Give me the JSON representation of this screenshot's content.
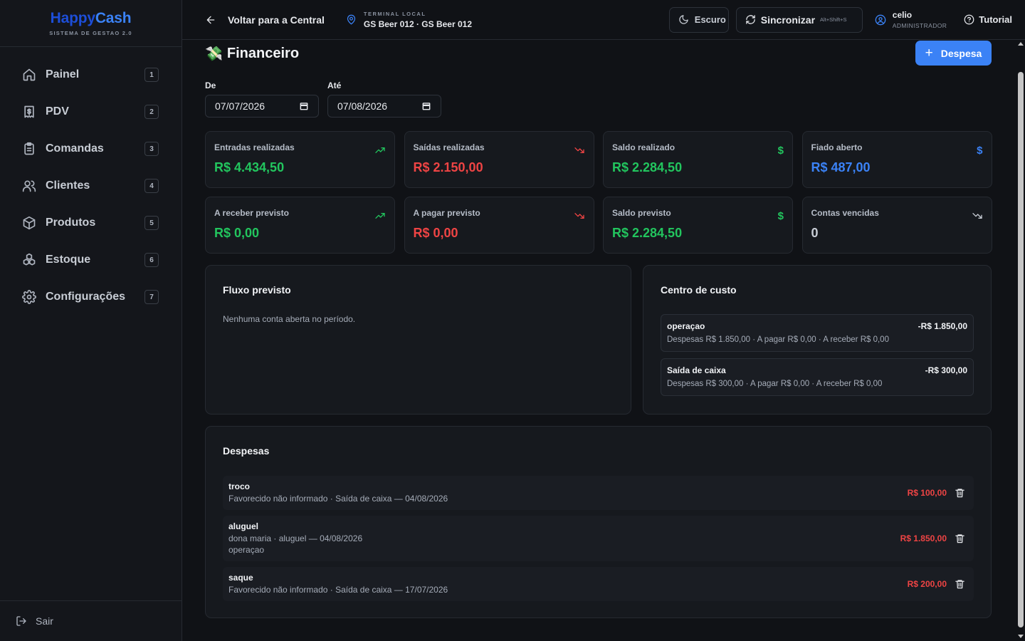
{
  "brand": {
    "name_part1": "Happy",
    "name_part2": "Cash",
    "subtitle": "SISTEMA DE GESTAO 2.0"
  },
  "sidebar": {
    "items": [
      {
        "label": "Painel",
        "shortcut": "1",
        "icon": "home-icon"
      },
      {
        "label": "PDV",
        "shortcut": "2",
        "icon": "receipt-icon"
      },
      {
        "label": "Comandas",
        "shortcut": "3",
        "icon": "clipboard-icon"
      },
      {
        "label": "Clientes",
        "shortcut": "4",
        "icon": "users-icon"
      },
      {
        "label": "Produtos",
        "shortcut": "5",
        "icon": "package-icon"
      },
      {
        "label": "Estoque",
        "shortcut": "6",
        "icon": "boxes-icon"
      },
      {
        "label": "Configurações",
        "shortcut": "7",
        "icon": "gear-icon"
      }
    ],
    "logout_label": "Sair"
  },
  "topbar": {
    "back_label": "Voltar para a Central",
    "terminal_kicker": "TERMINAL LOCAL",
    "terminal_name": "GS Beer 012 · GS Beer 012",
    "theme_label": "Escuro",
    "sync_label": "Sincronizar",
    "sync_shortcut": "Alt+Shift+S",
    "user_name": "celio",
    "user_role": "ADMINISTRADOR",
    "tutorial_label": "Tutorial"
  },
  "page": {
    "emoji": "💸",
    "title": "Financeiro",
    "add_button": "Despesa",
    "date_from_label": "De",
    "date_from_value": "07/07/2026",
    "date_to_label": "Até",
    "date_to_value": "07/08/2026"
  },
  "cards": [
    {
      "label": "Entradas realizadas",
      "value": "R$ 4.434,50",
      "color": "#22c55e",
      "icon": "trending-up-icon"
    },
    {
      "label": "Saídas realizadas",
      "value": "R$ 2.150,00",
      "color": "#ef4444",
      "icon": "trending-down-icon"
    },
    {
      "label": "Saldo realizado",
      "value": "R$ 2.284,50",
      "color": "#22c55e",
      "icon": "dollar-icon"
    },
    {
      "label": "Fiado aberto",
      "value": "R$ 487,00",
      "color": "#3b82f6",
      "icon": "dollar-icon"
    },
    {
      "label": "A receber previsto",
      "value": "R$ 0,00",
      "color": "#22c55e",
      "icon": "trending-up-icon"
    },
    {
      "label": "A pagar previsto",
      "value": "R$ 0,00",
      "color": "#ef4444",
      "icon": "trending-down-icon"
    },
    {
      "label": "Saldo previsto",
      "value": "R$ 2.284,50",
      "color": "#22c55e",
      "icon": "dollar-icon"
    },
    {
      "label": "Contas vencidas",
      "value": "0",
      "color": "#c8cdd5",
      "icon": "trending-down-icon"
    }
  ],
  "fluxo": {
    "title": "Fluxo previsto",
    "empty_message": "Nenhuma conta aberta no período."
  },
  "centro": {
    "title": "Centro de custo",
    "items": [
      {
        "name": "operaçao",
        "amount": "-R$ 1.850,00",
        "detail": "Despesas R$ 1.850,00 · A pagar R$ 0,00 · A receber R$ 0,00"
      },
      {
        "name": "Saída de caixa",
        "amount": "-R$ 300,00",
        "detail": "Despesas R$ 300,00 · A pagar R$ 0,00 · A receber R$ 0,00"
      }
    ]
  },
  "despesas": {
    "title": "Despesas",
    "items": [
      {
        "name": "troco",
        "line1": "Favorecido não informado · Saída de caixa — 04/08/2026",
        "line2": "",
        "amount": "R$ 100,00"
      },
      {
        "name": "aluguel",
        "line1": "dona maria · aluguel — 04/08/2026",
        "line2": "operaçao",
        "amount": "R$ 1.850,00"
      },
      {
        "name": "saque",
        "line1": "Favorecido não informado · Saída de caixa — 17/07/2026",
        "line2": "",
        "amount": "R$ 200,00"
      }
    ]
  },
  "colors": {
    "accent": "#3b82f6",
    "positive": "#22c55e",
    "negative": "#ef4444",
    "background": "#101216"
  }
}
